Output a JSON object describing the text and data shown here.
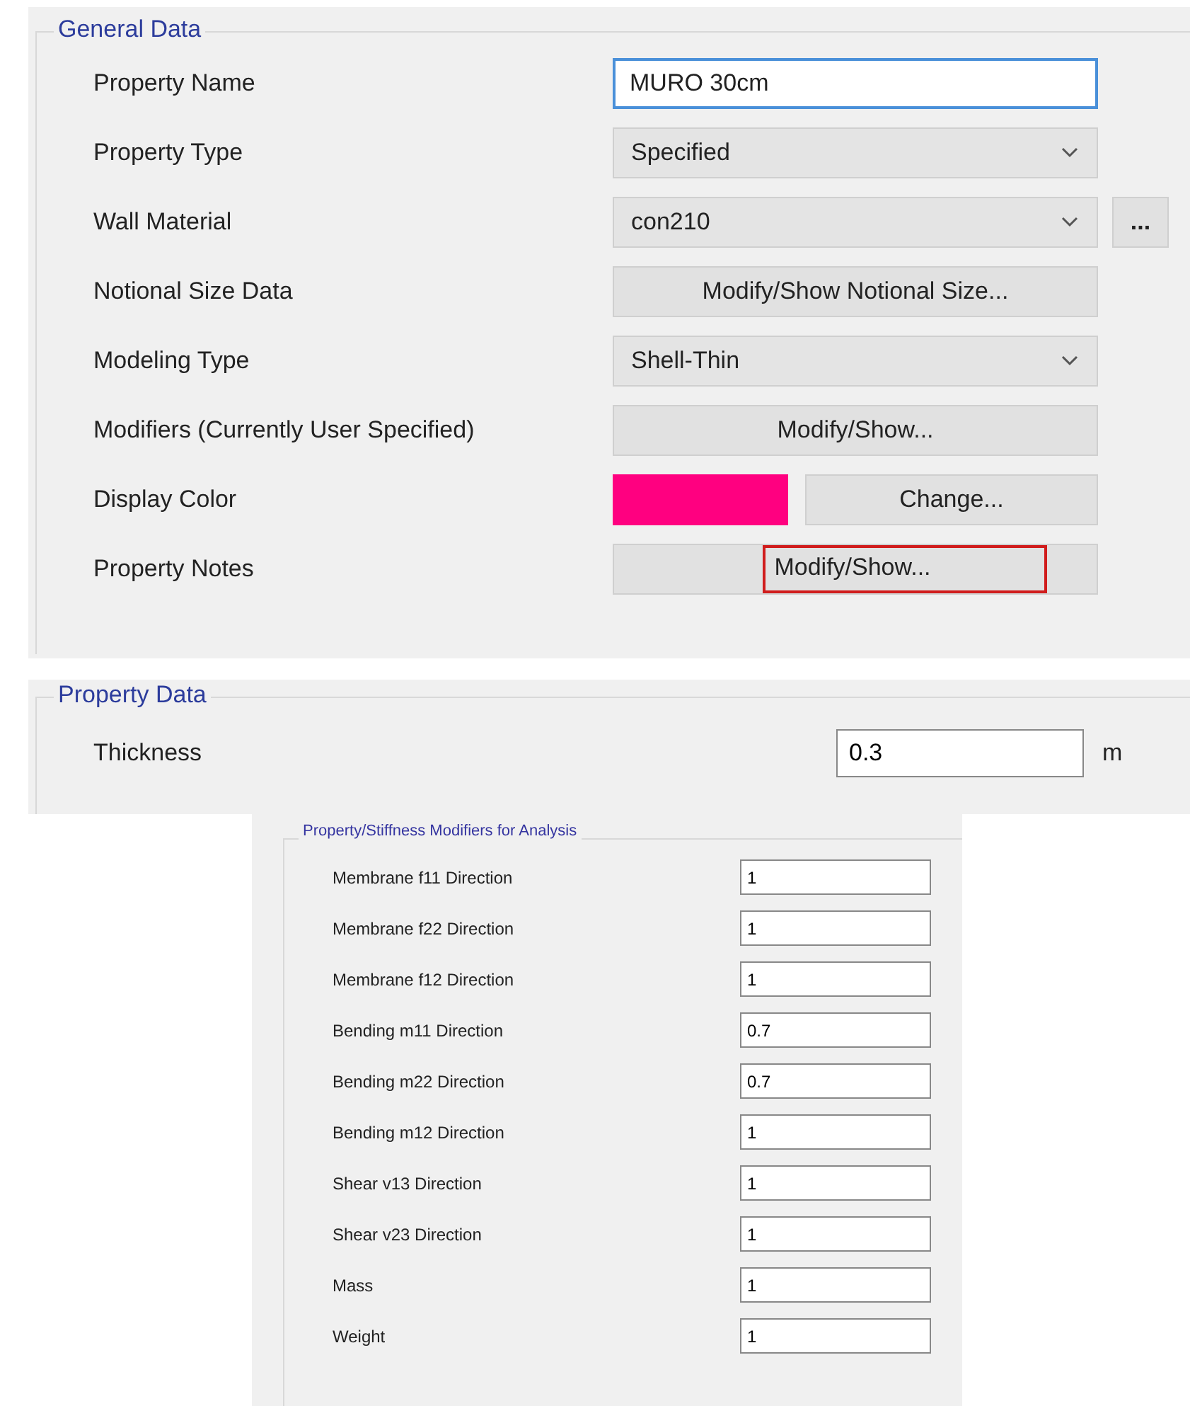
{
  "general_data": {
    "title": "General Data",
    "rows": [
      {
        "kind": "text",
        "label": "Property Name",
        "value": "MURO 30cm",
        "focused": true
      },
      {
        "kind": "dropdown",
        "label": "Property Type",
        "value": "Specified"
      },
      {
        "kind": "dropdown",
        "label": "Wall Material",
        "value": "con210",
        "extra_button": "..."
      },
      {
        "kind": "button",
        "label": "Notional Size Data",
        "button": "Modify/Show Notional Size...",
        "highlighted": false
      },
      {
        "kind": "dropdown",
        "label": "Modeling Type",
        "value": "Shell-Thin"
      },
      {
        "kind": "button",
        "label": "Modifiers (Currently User Specified)",
        "button": "Modify/Show...",
        "highlighted": false
      },
      {
        "kind": "color",
        "label": "Display Color",
        "color": "#ff0080",
        "button": "Change..."
      },
      {
        "kind": "button",
        "label": "Property Notes",
        "button": "Modify/Show...",
        "highlighted": true
      }
    ]
  },
  "property_data": {
    "title": "Property Data",
    "label": "Thickness",
    "value": "0.3",
    "unit": "m"
  },
  "modifiers": {
    "title": "Property/Stiffness Modifiers for Analysis",
    "rows": [
      {
        "label": "Membrane f11 Direction",
        "value": "1"
      },
      {
        "label": "Membrane f22 Direction",
        "value": "1"
      },
      {
        "label": "Membrane f12 Direction",
        "value": "1"
      },
      {
        "label": "Bending m11 Direction",
        "value": "0.7"
      },
      {
        "label": "Bending m22 Direction",
        "value": "0.7"
      },
      {
        "label": "Bending m12 Direction",
        "value": "1"
      },
      {
        "label": "Shear v13 Direction",
        "value": "1"
      },
      {
        "label": "Shear v23 Direction",
        "value": "1"
      },
      {
        "label": "Mass",
        "value": "1"
      },
      {
        "label": "Weight",
        "value": "1"
      }
    ]
  }
}
